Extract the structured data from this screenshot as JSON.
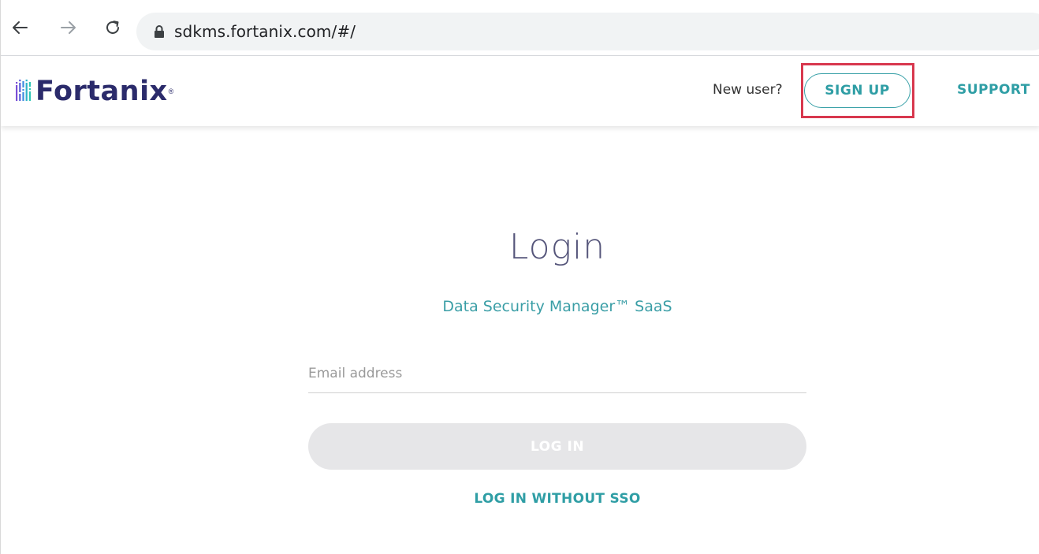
{
  "browser": {
    "url": "sdkms.fortanix.com/#/",
    "icons": {
      "back": "arrow-left-icon",
      "forward": "arrow-right-icon",
      "reload": "reload-icon",
      "lock": "lock-icon"
    }
  },
  "header": {
    "logo_text": "Fortanix",
    "logo_reg": "®",
    "new_user_text": "New user?",
    "signup_label": "SIGN UP",
    "support_label": "SUPPORT"
  },
  "login": {
    "title": "Login",
    "subtitle": "Data Security Manager™ SaaS",
    "email_placeholder": "Email address",
    "email_value": "",
    "login_button_label": "LOG IN",
    "login_without_sso_label": "LOG IN WITHOUT SSO"
  },
  "colors": {
    "accent": "#2f9ea5",
    "brand": "#2b2b6b",
    "highlight": "#d8384e",
    "disabled_button": "#e6e6e8"
  }
}
